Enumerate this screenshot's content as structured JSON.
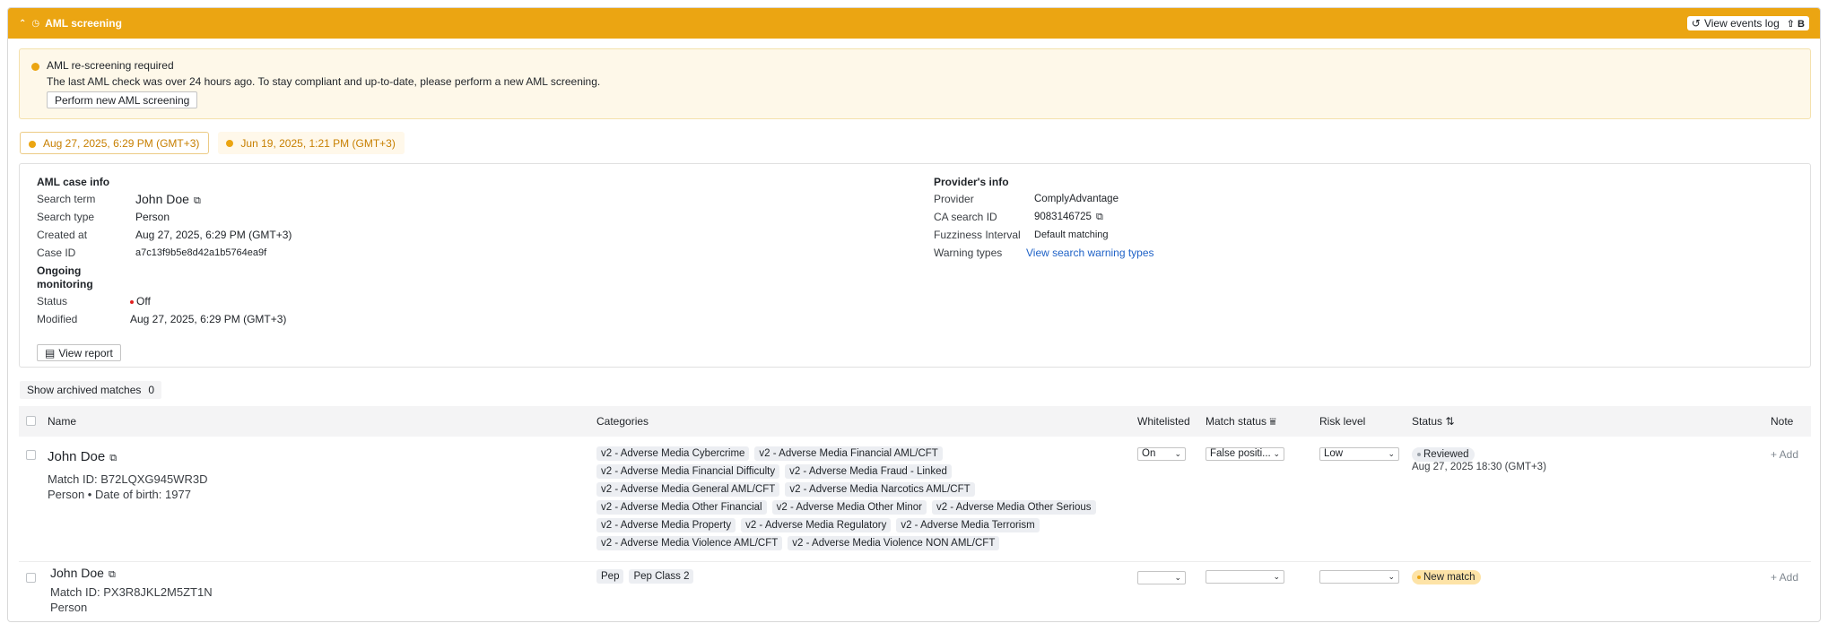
{
  "header": {
    "title": "AML screening",
    "events_log": "View events log",
    "shortcut": "⇧ B"
  },
  "alert": {
    "title": "AML re-screening required",
    "message": "The last AML check was over 24 hours ago. To stay compliant and up-to-date, please perform a new AML screening.",
    "action": "Perform new AML screening"
  },
  "date_tabs": [
    "Aug 27, 2025, 6:29 PM (GMT+3)",
    "Jun 19, 2025, 1:21 PM (GMT+3)"
  ],
  "case_info": {
    "title": "AML case info",
    "search_term_label": "Search term",
    "search_term": "John Doe",
    "search_type_label": "Search type",
    "search_type": "Person",
    "created_label": "Created at",
    "created": "Aug 27, 2025, 6:29 PM (GMT+3)",
    "case_id_label": "Case ID",
    "case_id": "a7c13f9b5e8d42a1b5764ea9f",
    "ongoing_label": "Ongoing monitoring",
    "status_label": "Status",
    "status": "Off",
    "modified_label": "Modified",
    "modified": "Aug 27, 2025, 6:29 PM (GMT+3)",
    "view_report": "View report"
  },
  "provider": {
    "title": "Provider's info",
    "provider_label": "Provider",
    "provider": "ComplyAdvantage",
    "ca_id_label": "CA search ID",
    "ca_id": "9083146725",
    "fuzz_label": "Fuzziness Interval",
    "fuzz": "Default matching",
    "warn_label": "Warning types",
    "warn": "View search warning types"
  },
  "archived": {
    "label": "Show archived matches",
    "count": "0"
  },
  "table": {
    "columns": [
      "Name",
      "Categories",
      "Whitelisted",
      "Match status",
      "Risk level",
      "Status",
      "Note"
    ],
    "rows": [
      {
        "name": "John Doe",
        "match_id": "Match ID: B72LQXG945WR3D",
        "meta": "Person • Date of birth: 1977",
        "categories": [
          "v2 - Adverse Media Cybercrime",
          "v2 - Adverse Media Financial AML/CFT",
          "v2 - Adverse Media Financial Difficulty",
          "v2 - Adverse Media Fraud - Linked",
          "v2 - Adverse Media General AML/CFT",
          "v2 - Adverse Media Narcotics AML/CFT",
          "v2 - Adverse Media Other Financial",
          "v2 - Adverse Media Other Minor",
          "v2 - Adverse Media Other Serious",
          "v2 - Adverse Media Property",
          "v2 - Adverse Media Regulatory",
          "v2 - Adverse Media Terrorism",
          "v2 - Adverse Media Violence AML/CFT",
          "v2 - Adverse Media Violence NON AML/CFT"
        ],
        "whitelisted": "On",
        "match_status": "False positi...",
        "risk": "Low",
        "status": "Reviewed",
        "status_time": "Aug 27, 2025 18:30 (GMT+3)",
        "note": "+ Add"
      },
      {
        "name": "John Doe",
        "match_id": "Match ID: PX3R8JKL2M5ZT1N",
        "meta": "Person",
        "categories": [
          "Pep",
          "Pep Class 2"
        ],
        "whitelisted": "",
        "match_status": "",
        "risk": "",
        "status": "New match",
        "status_time": "",
        "note": "+ Add"
      }
    ]
  },
  "colors": {
    "header": "#eba512",
    "link": "#1f62c7",
    "alert_bg": "#fef8e9",
    "new_badge": "#fde3a7"
  }
}
